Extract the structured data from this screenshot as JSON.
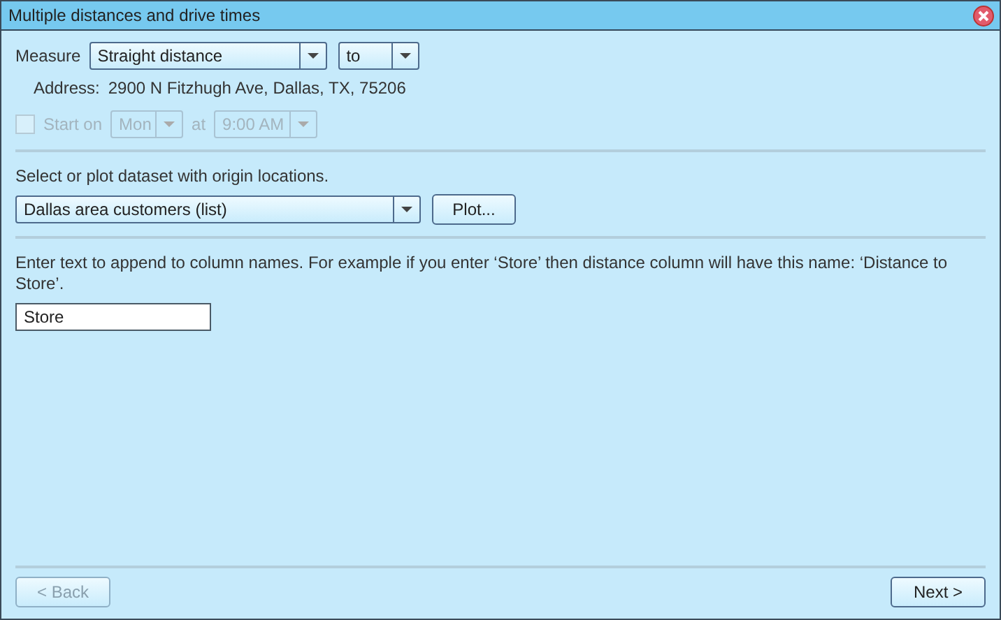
{
  "window": {
    "title": "Multiple distances and drive times"
  },
  "measure": {
    "label": "Measure",
    "value": "Straight distance",
    "direction": "to"
  },
  "address": {
    "label": "Address:",
    "value": "2900 N Fitzhugh Ave, Dallas, TX, 75206"
  },
  "start_on": {
    "label": "Start on",
    "checked": false,
    "disabled": true,
    "day": "Mon",
    "at_label": "at",
    "time": "9:00 AM"
  },
  "dataset": {
    "prompt": "Select or plot dataset with origin locations.",
    "value": "Dallas area customers (list)",
    "plot_button": "Plot..."
  },
  "suffix": {
    "prompt": "Enter text to append to column names. For example if you enter ‘Store’ then distance column will have this name: ‘Distance to Store’.",
    "value": "Store"
  },
  "buttons": [
    {
      "label": "< Back",
      "disabled": true
    },
    {
      "label": "Next >",
      "disabled": false
    }
  ]
}
